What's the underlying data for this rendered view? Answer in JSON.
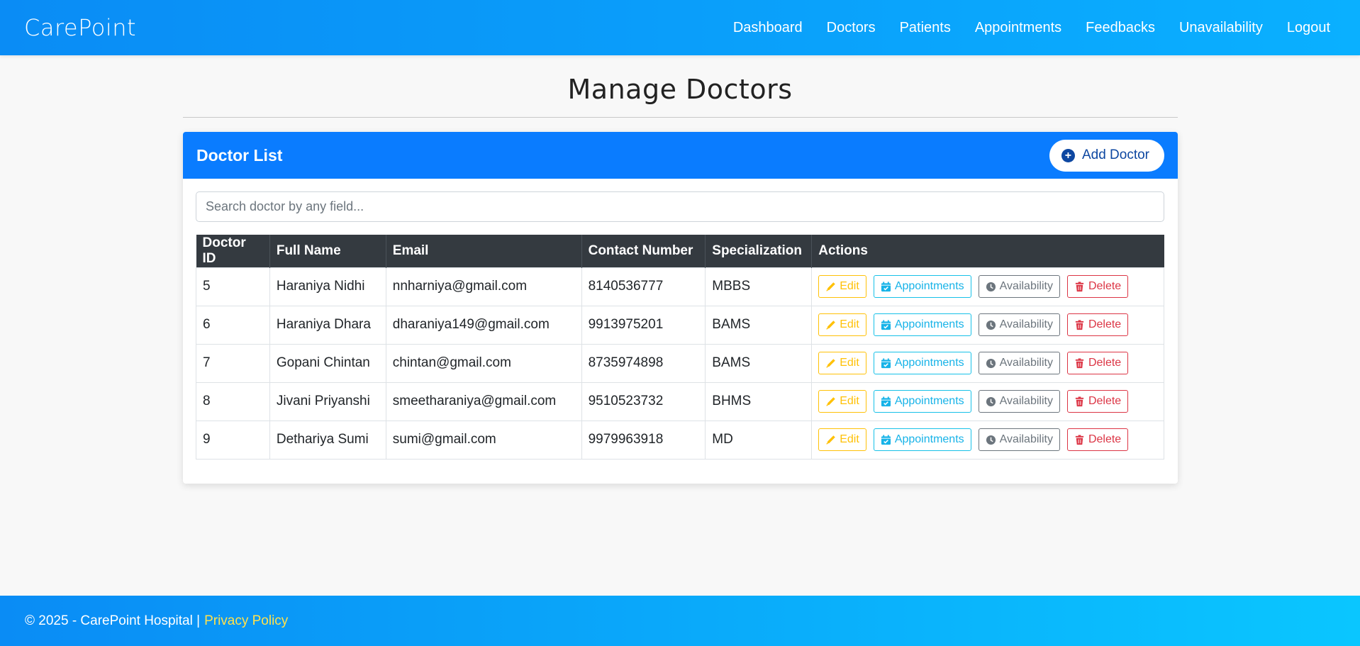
{
  "navbar": {
    "brand": "CarePoint",
    "links": [
      "Dashboard",
      "Doctors",
      "Patients",
      "Appointments",
      "Feedbacks",
      "Unavailability",
      "Logout"
    ]
  },
  "page": {
    "title": "Manage Doctors"
  },
  "card": {
    "title": "Doctor List",
    "add_button": "Add Doctor",
    "search_placeholder": "Search doctor by any field..."
  },
  "table": {
    "headers": [
      "Doctor ID",
      "Full Name",
      "Email",
      "Contact Number",
      "Specialization",
      "Actions"
    ],
    "rows": [
      [
        "5",
        "Haraniya Nidhi",
        "nnharniya@gmail.com",
        "8140536777",
        "MBBS"
      ],
      [
        "6",
        "Haraniya Dhara",
        "dharaniya149@gmail.com",
        "9913975201",
        "BAMS"
      ],
      [
        "7",
        "Gopani Chintan",
        "chintan@gmail.com",
        "8735974898",
        "BAMS"
      ],
      [
        "8",
        "Jivani Priyanshi",
        "smeetharaniya@gmail.com",
        "9510523732",
        "BHMS"
      ],
      [
        "9",
        "Dethariya Sumi",
        "sumi@gmail.com",
        "9979963918",
        "MD"
      ]
    ],
    "action_labels": {
      "edit": "Edit",
      "appointments": "Appointments",
      "availability": "Availability",
      "delete": "Delete"
    }
  },
  "footer": {
    "copyright": "© 2025 - CarePoint Hospital |",
    "privacy_link": "Privacy Policy"
  },
  "colors": {
    "nav_gradient_start": "#0a8cf5",
    "nav_gradient_end": "#0ab0ff",
    "card_header": "#0a7cff",
    "table_header": "#343a40",
    "edit": "#ffc107",
    "appointments": "#17b3e8",
    "availability": "#6c757d",
    "delete": "#dc3545",
    "footer_link": "#ffe14d"
  },
  "icons": {
    "add": "plus-circle-icon",
    "edit": "pencil-icon",
    "appointments": "calendar-check-icon",
    "availability": "clock-icon",
    "delete": "trash-icon"
  }
}
